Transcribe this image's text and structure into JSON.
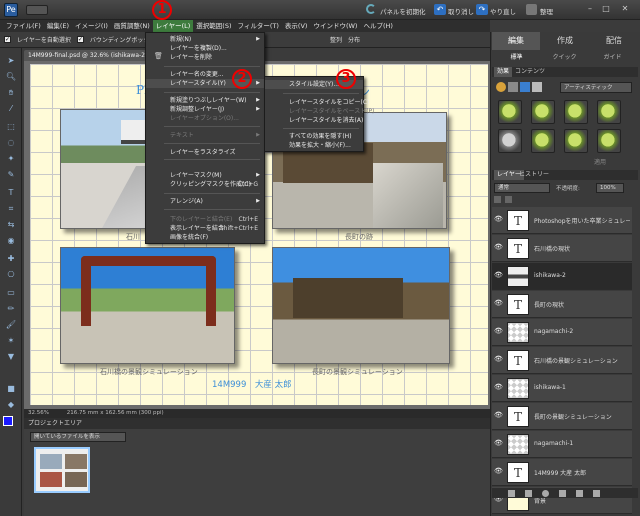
{
  "topbar": {
    "reset_panels": "パネルを初期化",
    "undo": "取り消し",
    "redo": "やり直し",
    "organize": "整理"
  },
  "menubar": [
    "ファイル(F)",
    "編集(E)",
    "イメージ(I)",
    "画質調整(N)",
    "レイヤー(L)",
    "選択範囲(S)",
    "フィルター(T)",
    "表示(V)",
    "ウインドウ(W)",
    "ヘルプ(H)"
  ],
  "options": {
    "auto_select": "レイヤーを自動選択",
    "bounding": "バウンディングボックスを表示",
    "arrange": "整列",
    "distribute": "分布"
  },
  "document": {
    "tab": "14M999-final.psd @ 32.6% (ishikawa-2, RGB/8)",
    "title_visible": "Ph",
    "title_tail": "ション",
    "captions": [
      "石川",
      "長町の跡",
      "石川橋の景観シミュレーション",
      "長町の景観シミュレーション"
    ],
    "author": "14M999　大産 太郎",
    "zoom": "32.56%",
    "size": "216.75 mm x 162.56 mm (300 ppi)"
  },
  "project": {
    "title": "プロジェクトエリア",
    "select": "開いているファイルを表示"
  },
  "layer_menu": {
    "items": [
      {
        "label": "新規(N)",
        "disabled": false,
        "arrow": true
      },
      {
        "label": "レイヤーを複製(D)...",
        "disabled": false
      },
      {
        "label": "レイヤーを削除",
        "disabled": false
      },
      {
        "label": "レイヤー名の変更...",
        "disabled": false
      },
      {
        "label": "レイヤースタイル(Y)",
        "disabled": false,
        "arrow": true,
        "highlight": true
      },
      {
        "label": "新規塗りつぶしレイヤー(W)",
        "disabled": false,
        "arrow": true
      },
      {
        "label": "新規調整レイヤー(J)",
        "disabled": false,
        "arrow": true
      },
      {
        "label": "レイヤーオプション(O)...",
        "disabled": true
      },
      {
        "label": "テキスト",
        "disabled": true,
        "arrow": true
      },
      {
        "label": "レイヤーをラスタライズ",
        "disabled": false
      },
      {
        "label": "レイヤーマスク(M)",
        "disabled": false,
        "arrow": true
      },
      {
        "label": "クリッピングマスクを作成(C)",
        "shortcut": "Ctrl+G",
        "disabled": false
      },
      {
        "label": "アレンジ(A)",
        "disabled": false,
        "arrow": true
      },
      {
        "label": "下のレイヤーと結合(E)",
        "shortcut": "Ctrl+E",
        "disabled": true
      },
      {
        "label": "表示レイヤーを結合",
        "shortcut": "Shift+Ctrl+E",
        "disabled": false
      },
      {
        "label": "画像を統合(F)",
        "disabled": false
      }
    ]
  },
  "style_menu": {
    "items": [
      {
        "label": "スタイル設定(Y)...",
        "disabled": false,
        "highlight": true
      },
      {
        "label": "レイヤースタイルをコピー(C)",
        "disabled": false
      },
      {
        "label": "レイヤースタイルをペースト(P)",
        "disabled": true
      },
      {
        "label": "レイヤースタイルを消去(A)",
        "disabled": false
      },
      {
        "label": "すべての効果を隠す(H)",
        "disabled": false
      },
      {
        "label": "効果を拡大・縮小(F)...",
        "disabled": false
      }
    ]
  },
  "badges": [
    "1",
    "2",
    "3"
  ],
  "right_panel": {
    "tabs": [
      "編集",
      "作成",
      "配信"
    ],
    "subtabs": [
      "標準",
      "クイック",
      "ガイド"
    ],
    "effects_tabs": [
      "効果",
      "コンテンツ"
    ],
    "effects_dropdown": "アーティスティック",
    "apply": "適用",
    "layers_tabs": [
      "レイヤー",
      "ヒストリー"
    ],
    "blend": "通常",
    "opacity_label": "不透明度:",
    "opacity": "100%"
  },
  "layers": [
    {
      "name": "Photoshopを用いた卒業シミュレー",
      "thumb": "T",
      "kind": "text"
    },
    {
      "name": "石川橋の現状",
      "thumb": "T",
      "kind": "text"
    },
    {
      "name": "ishikawa-2",
      "thumb": "",
      "kind": "image",
      "selected": true
    },
    {
      "name": "長町の現状",
      "thumb": "T",
      "kind": "text"
    },
    {
      "name": "nagamachi-2",
      "thumb": "",
      "kind": "checker"
    },
    {
      "name": "石川橋の景観シミュレーション",
      "thumb": "T",
      "kind": "text"
    },
    {
      "name": "ishikawa-1",
      "thumb": "",
      "kind": "checker"
    },
    {
      "name": "長町の景観シミュレーション",
      "thumb": "T",
      "kind": "text"
    },
    {
      "name": "nagamachi-1",
      "thumb": "",
      "kind": "checker"
    },
    {
      "name": "14M999 大産 太郎",
      "thumb": "T",
      "kind": "text"
    },
    {
      "name": "背景",
      "thumb": "",
      "kind": "yellow"
    }
  ],
  "colors": {
    "active_menu": "#3d7b3d",
    "title_blue": "#3d8fd8",
    "badge_red": "#ee0000",
    "canvas_bg": "#fffbd8"
  }
}
